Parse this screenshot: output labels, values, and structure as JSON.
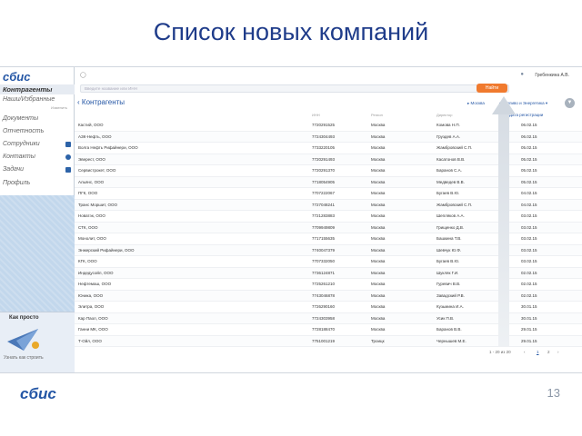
{
  "slide": {
    "title": "Список новых компаний",
    "page_number": "13",
    "footer_logo": "сбис"
  },
  "sidebar": {
    "logo": "сбис",
    "items": [
      {
        "label": "Контрагенты",
        "active": true
      },
      {
        "label": "Наши/Избранные",
        "sub": "Изменить"
      },
      {
        "label": "Документы"
      },
      {
        "label": "Отчетность"
      },
      {
        "label": "Сотрудники"
      },
      {
        "label": "Контакты"
      },
      {
        "label": "Задачи"
      },
      {
        "label": "Профиль"
      }
    ],
    "promo_title": "Как просто",
    "promo_link": "Узнать как строить"
  },
  "topbar": {
    "user_name": "Гребенкина А.В.",
    "search_placeholder": "Введите название или ИНН",
    "find_button": "Найти"
  },
  "main": {
    "section_title": "Контрагенты",
    "filters": [
      "Москва",
      "Топливо и Энергетика"
    ],
    "sort_label": "Дата регистрации",
    "columns": [
      "ИНН",
      "Регион",
      "Директор"
    ]
  },
  "rows": [
    {
      "name": "Кастий, ООО",
      "inn": "7720291525",
      "city": "Москва",
      "director": "Комова Н.П.",
      "date": "06.02.15"
    },
    {
      "name": "АЗК-Нефть, ООО",
      "inn": "7724304493",
      "city": "Москва",
      "director": "Груздев А.А.",
      "date": "06.02.15"
    },
    {
      "name": "Волга Нефть Рифайнери, ООО",
      "inn": "7733220105",
      "city": "Москва",
      "director": "Жамбровский С.П.",
      "date": "05.02.15"
    },
    {
      "name": "Эверест, ООО",
      "inn": "7720291493",
      "city": "Москва",
      "director": "Касатонов В.В.",
      "date": "05.02.15"
    },
    {
      "name": "Сервистрокет, ООО",
      "inn": "7720291370",
      "city": "Москва",
      "director": "Баранов С.А.",
      "date": "05.02.15"
    },
    {
      "name": "Альянс, ООО",
      "inn": "7718054905",
      "city": "Москва",
      "director": "Медведев В.В.",
      "date": "05.02.15"
    },
    {
      "name": "ПГК, ООО",
      "inn": "7707222067",
      "city": "Москва",
      "director": "Бугаев В.Ю.",
      "date": "04.02.15"
    },
    {
      "name": "Транс Моршит, ООО",
      "inn": "7727048241",
      "city": "Москва",
      "director": "Жамбровский С.П.",
      "date": "04.02.15"
    },
    {
      "name": "Новатэк, ООО",
      "inn": "7721283883",
      "city": "Москва",
      "director": "Шепляков А.А.",
      "date": "03.02.15"
    },
    {
      "name": "СТК, ООО",
      "inn": "7709949809",
      "city": "Москва",
      "director": "Грищенко Д.В.",
      "date": "03.02.15"
    },
    {
      "name": "Монолит, ООО",
      "inn": "7717155635",
      "city": "Москва",
      "director": "Башкина Т.В.",
      "date": "03.02.15"
    },
    {
      "name": "Энжерский Рифайнери, ООО",
      "inn": "7740047379",
      "city": "Москва",
      "director": "Шевчук Ю.Ф.",
      "date": "03.02.15"
    },
    {
      "name": "КГК, ООО",
      "inn": "7707332050",
      "city": "Москва",
      "director": "Бугаев В.Ю.",
      "date": "03.02.15"
    },
    {
      "name": "Индедусойл, ООО",
      "inn": "7736124871",
      "city": "Москва",
      "director": "Шукляк Г.И.",
      "date": "02.02.15"
    },
    {
      "name": "Нефтемаш, ООО",
      "inn": "7725261210",
      "city": "Москва",
      "director": "Гуревич В.В.",
      "date": "02.02.15"
    },
    {
      "name": "Юника, ООО",
      "inn": "7743046878",
      "city": "Москва",
      "director": "Завадский Р.В.",
      "date": "02.02.15"
    },
    {
      "name": "Элитра, ООО",
      "inn": "7726290160",
      "city": "Москва",
      "director": "Кузьмина И.А.",
      "date": "30.01.15"
    },
    {
      "name": "Кар Паол, ООО",
      "inn": "7724303958",
      "city": "Москва",
      "director": "Усик П.В.",
      "date": "30.01.15"
    },
    {
      "name": "Ганни МК, ООО",
      "inn": "7728188470",
      "city": "Москва",
      "director": "Баранов В.В.",
      "date": "29.01.15"
    },
    {
      "name": "Т-Ойл, ООО",
      "inn": "7751001219",
      "city": "Троицк",
      "director": "Чернышев М.Е.",
      "date": "29.01.15"
    }
  ],
  "pager": {
    "range": "1 - 20 из 20",
    "pages": [
      "1",
      "2"
    ],
    "active_page": "1"
  }
}
